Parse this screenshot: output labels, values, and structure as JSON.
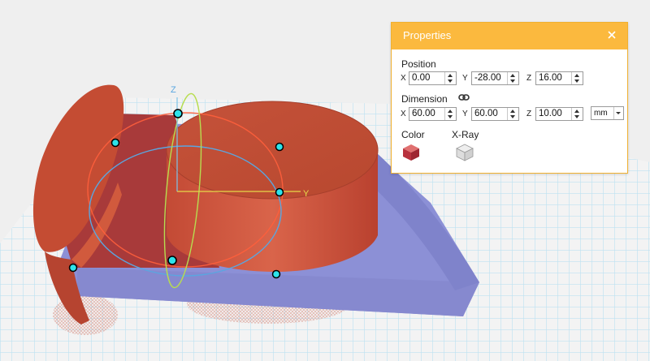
{
  "scene": {
    "grid_color": "#9fd3ea",
    "object_color": "#c8553a",
    "base_color": "#8b8fd8",
    "gizmo_axes": {
      "z_label": "Z",
      "y_label": "Y"
    }
  },
  "properties": {
    "title": "Properties",
    "position": {
      "label": "Position",
      "x_label": "X",
      "x": "0.00",
      "y_label": "Y",
      "y": "-28.00",
      "z_label": "Z",
      "z": "16.00"
    },
    "dimension": {
      "label": "Dimension",
      "link_icon": "link-icon",
      "x_label": "X",
      "x": "60.00",
      "y_label": "Y",
      "y": "60.00",
      "z_label": "Z",
      "z": "10.00",
      "unit": "mm"
    },
    "color": {
      "label": "Color",
      "value": "#c8474a"
    },
    "xray": {
      "label": "X-Ray"
    }
  }
}
